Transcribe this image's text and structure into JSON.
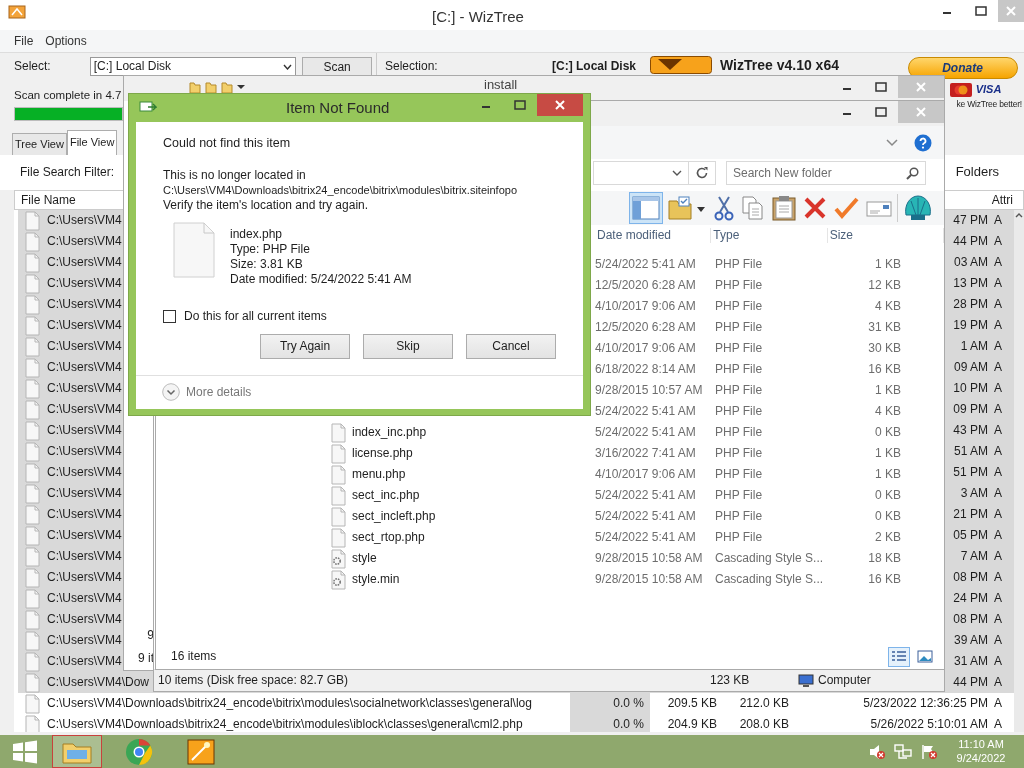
{
  "wiztree": {
    "title": "[C:] - WizTree",
    "menu": [
      "File",
      "Options"
    ],
    "select_label": "Select:",
    "drive_select": "[C:] Local Disk",
    "scan_button": "Scan",
    "status": "Scan complete in 4.7",
    "progress": {
      "level": 1
    },
    "selection_label": "Selection:",
    "selection_value": "[C:] Local Disk",
    "product": "WizTree v4.10 x64",
    "donate_button": "Donate",
    "card_brand": "VISA",
    "donate_note": "ke WizTree better!",
    "tabs": [
      {
        "label": "Tree View",
        "selected": false
      },
      {
        "label": "File View",
        "selected": true
      }
    ],
    "filter_label": "File Search Filter:",
    "folders_label": "Folders",
    "columns": [
      "File Name",
      "Attri"
    ],
    "rows": [
      {
        "path": "C:\\Users\\VM4",
        "date": "47 PM",
        "attr": "A",
        "selected": true
      },
      {
        "path": "C:\\Users\\VM4",
        "date": "44 PM",
        "attr": "A",
        "selected": true
      },
      {
        "path": "C:\\Users\\VM4",
        "date": "03 AM",
        "attr": "A",
        "selected": true
      },
      {
        "path": "C:\\Users\\VM4",
        "date": "13 PM",
        "attr": "A",
        "selected": true
      },
      {
        "path": "C:\\Users\\VM4",
        "date": "28 PM",
        "attr": "A",
        "selected": true
      },
      {
        "path": "C:\\Users\\VM4",
        "date": "19 PM",
        "attr": "A",
        "selected": true
      },
      {
        "path": "C:\\Users\\VM4",
        "date": "1 AM",
        "attr": "A",
        "selected": true
      },
      {
        "path": "C:\\Users\\VM4",
        "date": "09 AM",
        "attr": "A",
        "selected": true
      },
      {
        "path": "C:\\Users\\VM4",
        "date": "10 PM",
        "attr": "A",
        "selected": true
      },
      {
        "path": "C:\\Users\\VM4",
        "date": "09 PM",
        "attr": "A",
        "selected": true
      },
      {
        "path": "C:\\Users\\VM4",
        "date": "43 PM",
        "attr": "A",
        "selected": true
      },
      {
        "path": "C:\\Users\\VM4",
        "date": "51 AM",
        "attr": "A",
        "selected": true
      },
      {
        "path": "C:\\Users\\VM4",
        "date": "51 PM",
        "attr": "A",
        "selected": true
      },
      {
        "path": "C:\\Users\\VM4",
        "date": "3 AM",
        "attr": "A",
        "selected": true
      },
      {
        "path": "C:\\Users\\VM4",
        "date": "21 PM",
        "attr": "A",
        "selected": true
      },
      {
        "path": "C:\\Users\\VM4",
        "date": "05 PM",
        "attr": "A",
        "selected": true
      },
      {
        "path": "C:\\Users\\VM4",
        "date": "7 AM",
        "attr": "A",
        "selected": true
      },
      {
        "path": "C:\\Users\\VM4",
        "date": "08 PM",
        "attr": "A",
        "selected": true
      },
      {
        "path": "C:\\Users\\VM4",
        "date": "24 PM",
        "attr": "A",
        "selected": true
      },
      {
        "path": "C:\\Users\\VM4",
        "date": "08 PM",
        "attr": "A",
        "selected": true
      },
      {
        "path": "C:\\Users\\VM4",
        "date": "39 AM",
        "attr": "A",
        "selected": true
      },
      {
        "path": "C:\\Users\\VM4",
        "date": "31 AM",
        "attr": "A",
        "selected": true
      },
      {
        "path": "C:\\Users\\VM4\\Dow",
        "date": "44 PM",
        "attr": "A",
        "selected": true
      },
      {
        "path": "C:\\Users\\VM4\\Downloads\\bitrix24_encode\\bitrix\\modules\\socialnetwork\\classes\\general\\log",
        "percent": "0.0 %",
        "size": "209.5 KB",
        "allocated": "212.0 KB",
        "date": "5/23/2022 12:36:25 PM",
        "attr": "A",
        "selected": false
      },
      {
        "path": "C:\\Users\\VM4\\Downloads\\bitrix24_encode\\bitrix\\modules\\iblock\\classes\\general\\cml2.php",
        "percent": "0.0 %",
        "size": "204.9 KB",
        "allocated": "208.0 KB",
        "date": "5/26/2022 5:10:01 AM",
        "attr": "A",
        "selected": false
      }
    ]
  },
  "explorer_back": {
    "title": "install",
    "pane_texts": [
      "9",
      "9 it"
    ],
    "status_items": "10 items (Disk free space: 82.7 GB)",
    "status_size": "123 KB",
    "status_location": "Computer"
  },
  "explorer": {
    "search_placeholder": "Search New folder",
    "toolbar": [
      {
        "kind": "pane",
        "on": true
      },
      {
        "kind": "folder"
      },
      {
        "kind": "cut"
      },
      {
        "kind": "copy"
      },
      {
        "kind": "paste"
      },
      {
        "kind": "delete"
      },
      {
        "kind": "check"
      },
      {
        "kind": "card"
      },
      {
        "kind": "shell"
      }
    ],
    "columns": [
      "Date modified",
      "Type",
      "Size"
    ],
    "rows": [
      {
        "date": "5/24/2022 5:41 AM",
        "type": "PHP File",
        "size": "1 KB"
      },
      {
        "date": "12/5/2020 6:28 AM",
        "type": "PHP File",
        "size": "12 KB"
      },
      {
        "date": "4/10/2017 9:06 AM",
        "type": "PHP File",
        "size": "4 KB"
      },
      {
        "date": "12/5/2020 6:28 AM",
        "type": "PHP File",
        "size": "31 KB"
      },
      {
        "date": "4/10/2017 9:06 AM",
        "type": "PHP File",
        "size": "30 KB"
      },
      {
        "date": "6/18/2022 8:14 AM",
        "type": "PHP File",
        "size": "16 KB"
      },
      {
        "date": "9/28/2015 10:57 AM",
        "type": "PHP File",
        "size": "1 KB"
      },
      {
        "date": "5/24/2022 5:41 AM",
        "type": "PHP File",
        "size": "4 KB"
      },
      {
        "kind": "php",
        "name": "index_inc.php",
        "date": "5/24/2022 5:41 AM",
        "type": "PHP File",
        "size": "0 KB"
      },
      {
        "kind": "php",
        "name": "license.php",
        "date": "3/16/2022 7:41 AM",
        "type": "PHP File",
        "size": "1 KB"
      },
      {
        "kind": "php",
        "name": "menu.php",
        "date": "4/10/2017 9:06 AM",
        "type": "PHP File",
        "size": "1 KB"
      },
      {
        "kind": "php",
        "name": "sect_inc.php",
        "date": "5/24/2022 5:41 AM",
        "type": "PHP File",
        "size": "0 KB"
      },
      {
        "kind": "php",
        "name": "sect_incleft.php",
        "date": "5/24/2022 5:41 AM",
        "type": "PHP File",
        "size": "0 KB"
      },
      {
        "kind": "php",
        "name": "sect_rtop.php",
        "date": "5/24/2022 5:41 AM",
        "type": "PHP File",
        "size": "2 KB"
      },
      {
        "kind": "css",
        "name": "style",
        "date": "9/28/2015 10:58 AM",
        "type": "Cascading Style S...",
        "size": "18 KB"
      },
      {
        "kind": "css",
        "name": "style.min",
        "date": "9/28/2015 10:58 AM",
        "type": "Cascading Style S...",
        "size": "16 KB"
      }
    ],
    "status": "16 items",
    "views": [
      {
        "kind": "details",
        "selected": true
      },
      {
        "kind": "tiles",
        "selected": false
      }
    ]
  },
  "dialog": {
    "title": "Item Not Found",
    "heading": "Could not find this item",
    "lines": [
      "This is no longer located in",
      "C:\\Users\\VM4\\Downloads\\bitrix24_encode\\bitrix\\modules\\bitrix.siteinfopo",
      "Verify the item's location and try again."
    ],
    "file": [
      "index.php",
      "Type: PHP File",
      "Size: 3.81 KB",
      "Date modified: 5/24/2022 5:41 AM"
    ],
    "checkbox": {
      "label": "Do this for all current items",
      "checked": false
    },
    "buttons": [
      "Try Again",
      "Skip",
      "Cancel"
    ],
    "more": "More details"
  },
  "taskbar": {
    "apps": [
      {
        "kind": "explorer",
        "selected": true
      },
      {
        "kind": "browser",
        "selected": false
      },
      {
        "kind": "wiztree",
        "selected": false
      }
    ],
    "time": "11:10 AM",
    "date": "9/24/2022"
  }
}
